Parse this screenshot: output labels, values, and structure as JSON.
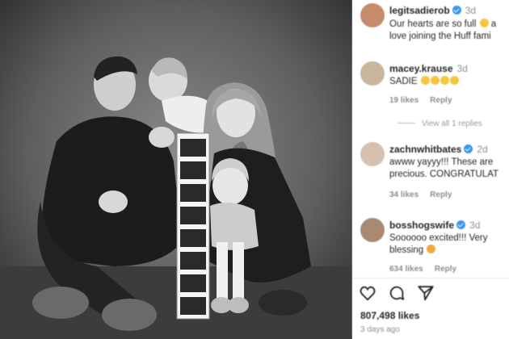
{
  "post": {
    "author": "legitsadierob",
    "time": "3d",
    "caption_line1": "Our hearts are so full",
    "caption_line1_rest": "a",
    "caption_line2": "love joining the Huff fami"
  },
  "comments": [
    {
      "user": "macey.krause",
      "time": "3d",
      "text": "SADIE",
      "text_emojis": 4,
      "likes": "19 likes",
      "reply": "Reply",
      "view_replies": "View all 1 replies"
    },
    {
      "user": "zachnwhitbates",
      "time": "2d",
      "text_line1": "awww yayyy!!! These are",
      "text_line2": "precious. CONGRATULAT",
      "likes": "34 likes",
      "reply": "Reply"
    },
    {
      "user": "bosshogswife",
      "time": "3d",
      "text_line1": "Soooooo excited!!! Very",
      "text_line2": "blessing",
      "likes": "634 likes",
      "reply": "Reply"
    }
  ],
  "footer": {
    "likes": "807,498 likes",
    "posted": "3 days ago"
  },
  "icons": [
    "heart-icon",
    "comment-icon",
    "share-icon"
  ],
  "colors": {
    "verified": "#3897f0",
    "text": "#262626",
    "muted": "#8e8e8e"
  }
}
